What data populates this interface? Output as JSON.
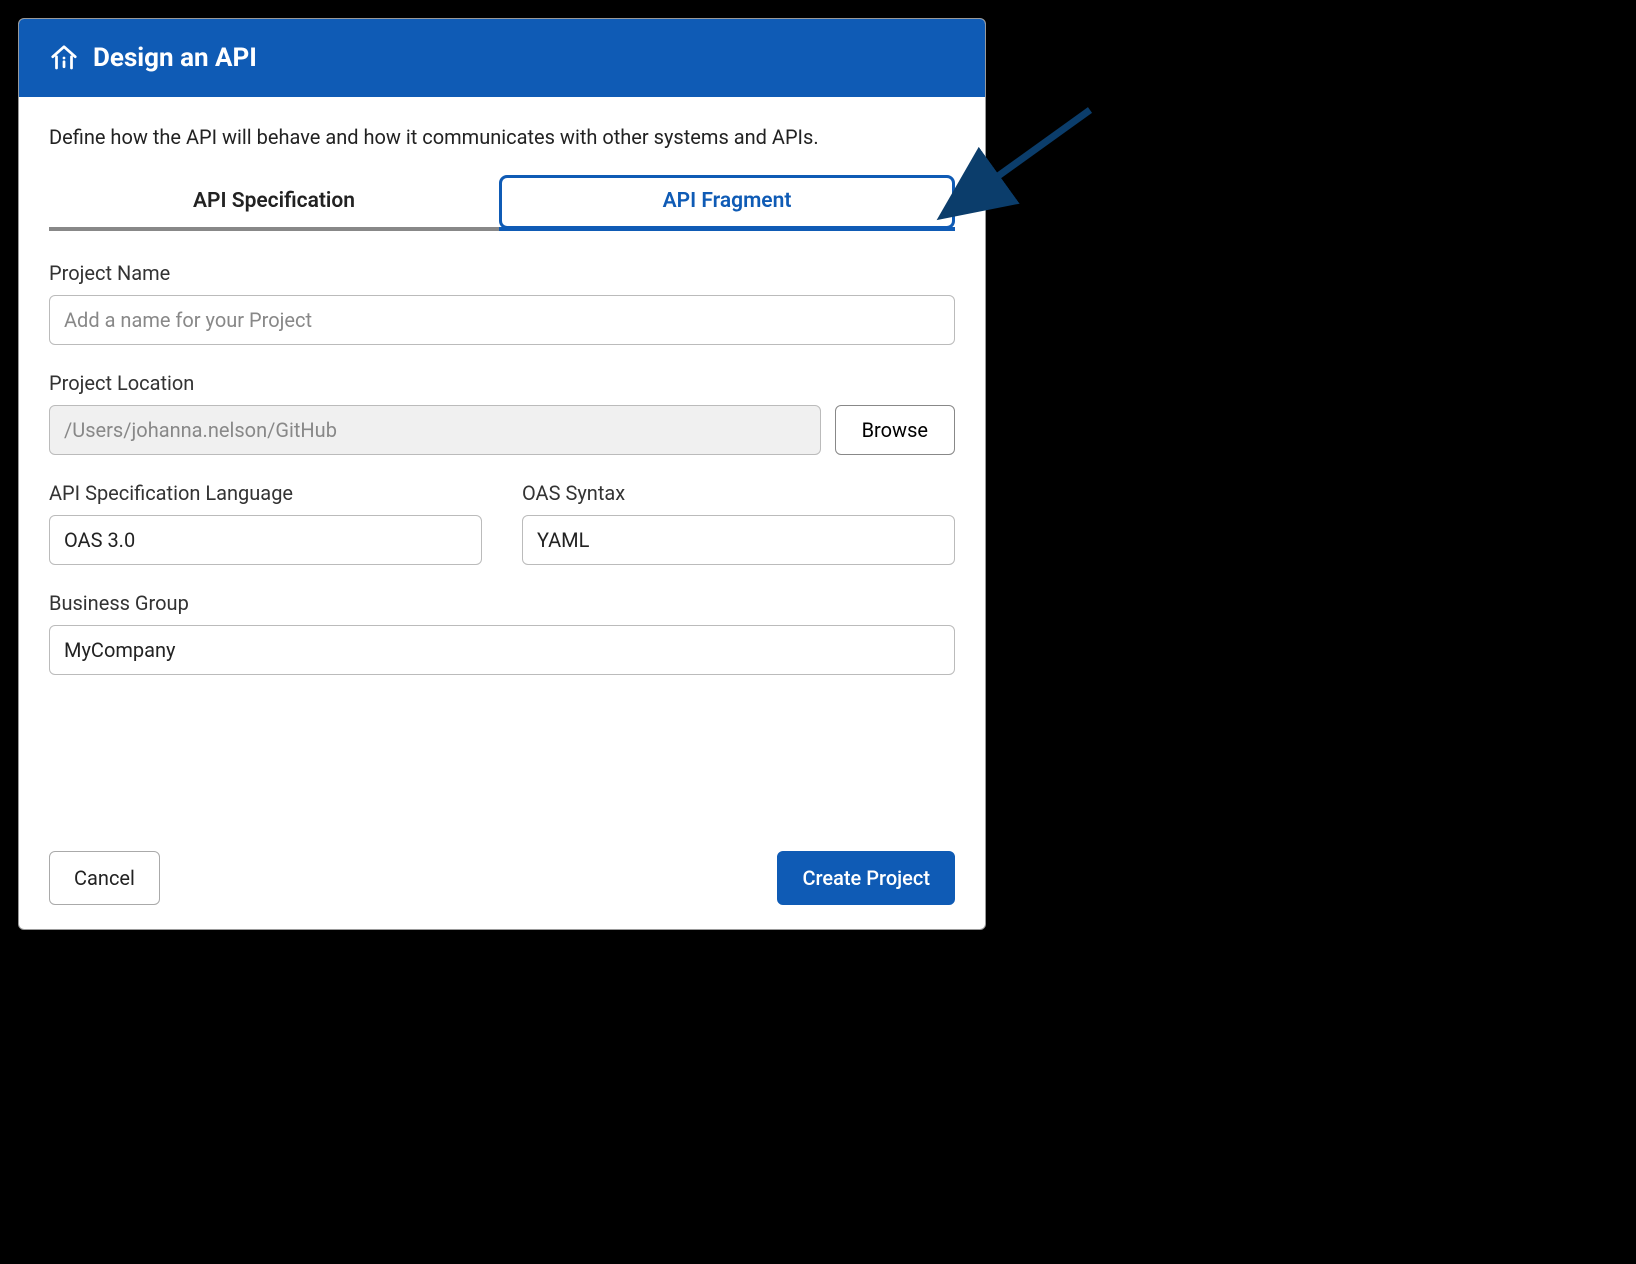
{
  "header": {
    "title": "Design an API"
  },
  "description": "Define how the API will behave and how it communicates with other systems and APIs.",
  "tabs": {
    "specification": "API Specification",
    "fragment": "API Fragment"
  },
  "form": {
    "projectName": {
      "label": "Project Name",
      "placeholder": "Add a name for your Project",
      "value": ""
    },
    "projectLocation": {
      "label": "Project Location",
      "value": "/Users/johanna.nelson/GitHub",
      "browseLabel": "Browse"
    },
    "apiSpecLanguage": {
      "label": "API Specification Language",
      "value": "OAS 3.0"
    },
    "oasSyntax": {
      "label": "OAS Syntax",
      "value": "YAML"
    },
    "businessGroup": {
      "label": "Business Group",
      "value": "MyCompany"
    }
  },
  "footer": {
    "cancel": "Cancel",
    "create": "Create Project"
  }
}
